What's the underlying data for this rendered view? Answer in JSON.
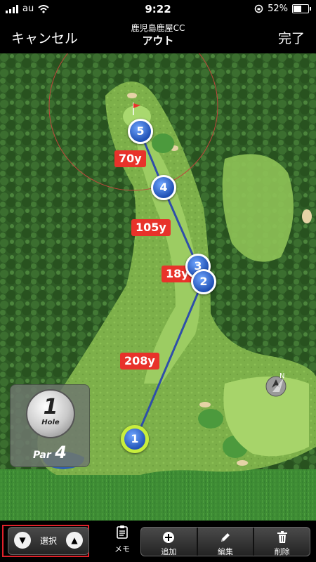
{
  "status_bar": {
    "carrier": "au",
    "time": "9:22",
    "battery_percent": "52%"
  },
  "nav": {
    "cancel_label": "キャンセル",
    "course_name": "鹿児島鹿屋CC",
    "round_name": "アウト",
    "done_label": "完了"
  },
  "map": {
    "shots": [
      {
        "number": "1",
        "role": "tee"
      },
      {
        "number": "2",
        "role": "shot"
      },
      {
        "number": "3",
        "role": "shot"
      },
      {
        "number": "4",
        "role": "shot"
      },
      {
        "number": "5",
        "role": "shot"
      }
    ],
    "distances": [
      "208y",
      "18y",
      "105y",
      "70y"
    ],
    "compass_label": "N",
    "flag_color": "#e8322a",
    "route_color": "#2f4fa8"
  },
  "hole_badge": {
    "hole_number": "1",
    "hole_word": "Hole",
    "par_word": "Par",
    "par_value": "4"
  },
  "toolbar": {
    "select_label": "選択",
    "memo_label": "メモ",
    "add_label": "追加",
    "edit_label": "編集",
    "delete_label": "削除"
  },
  "icons": {
    "select_down": "chevron-down-icon",
    "select_up": "chevron-up-icon",
    "memo": "clipboard-icon",
    "add": "plus-circle-icon",
    "edit": "pencil-icon",
    "delete": "trash-icon",
    "wifi": "wifi-icon",
    "battery": "battery-icon",
    "compass": "compass-icon",
    "flag": "pin-flag-icon"
  }
}
